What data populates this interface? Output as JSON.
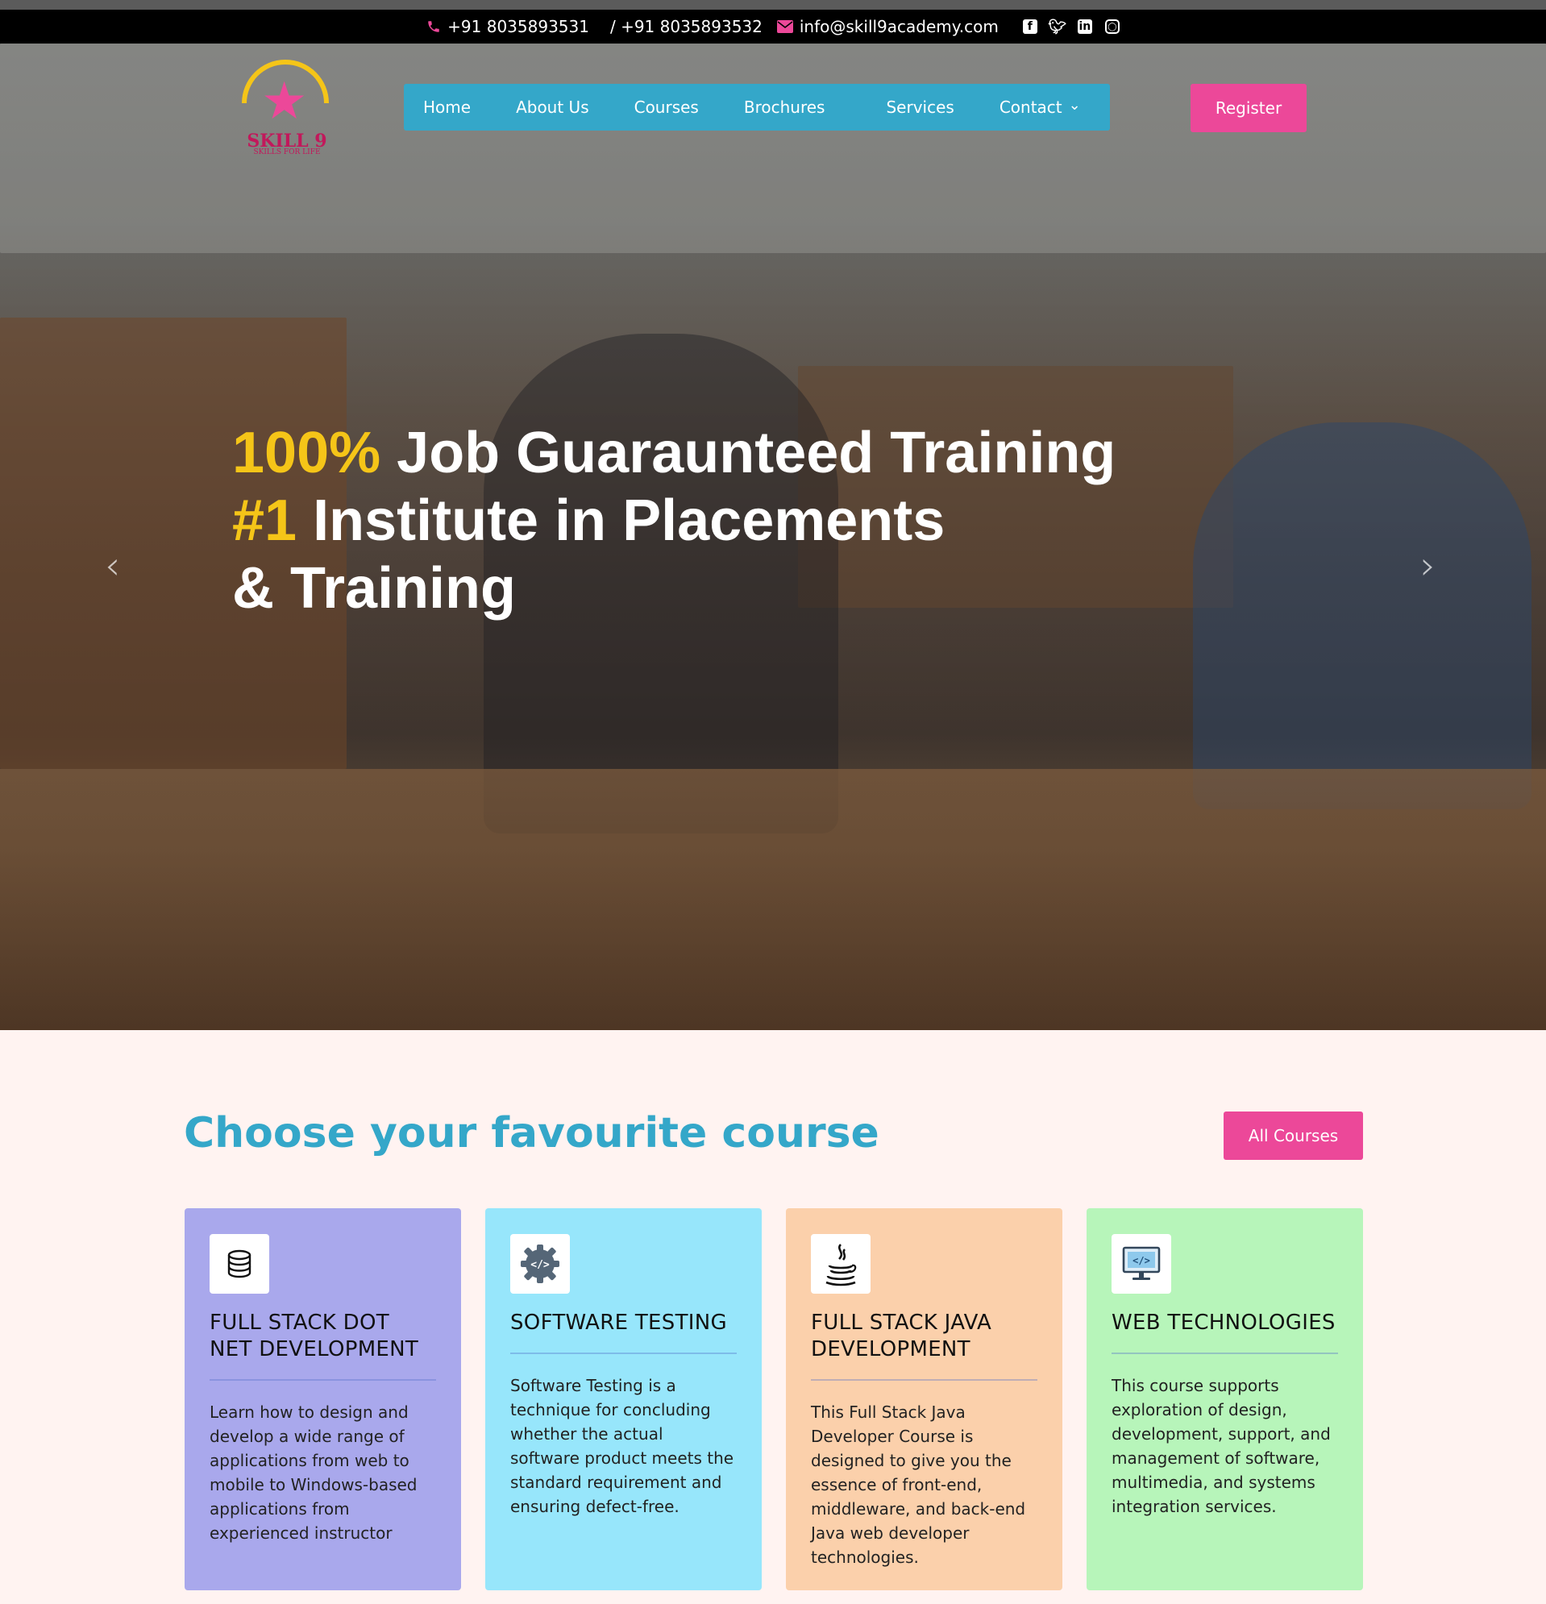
{
  "topbar": {
    "phone1": "+91 8035893531",
    "phone2": "/ +91 8035893532",
    "email": "info@skill9academy.com",
    "social_icons": [
      "facebook-icon",
      "twitter-icon",
      "linkedin-icon",
      "instagram-icon"
    ]
  },
  "logo": {
    "name": "SKILL 9",
    "tagline": "SKILLS FOR LIFE"
  },
  "nav": {
    "items": [
      "Home",
      "About Us",
      "Courses",
      "Brochures",
      "Services",
      "Contact"
    ],
    "register": "Register"
  },
  "hero": {
    "line1_highlight": "100%",
    "line1_rest": " Job Guaraunteed Training",
    "line2_highlight": "#1",
    "line2_rest": " Institute in Placements",
    "line3": "& Training",
    "slides_count": 2,
    "active_slide": 1
  },
  "courses": {
    "title": "Choose your favourite course",
    "all_button": "All Courses",
    "items": [
      {
        "title": "FULL STACK DOT NET DEVELOPMENT",
        "description": "Learn how to design and develop a wide range of applications from web to mobile to Windows-based applications from experienced instructor",
        "color": "#a9a8ec",
        "icon": "database-icon"
      },
      {
        "title": "SOFTWARE TESTING",
        "description": "Software Testing is a technique for concluding whether the actual software product meets the standard requirement and ensuring defect-free.",
        "color": "#97e6fb",
        "icon": "code-gear-icon"
      },
      {
        "title": "FULL STACK JAVA DEVELOPMENT",
        "description": "This Full Stack Java Developer Course is designed to give you the essence of front-end, middleware, and back-end Java web developer technologies.",
        "color": "#fbd0ab",
        "icon": "java-icon"
      },
      {
        "title": "WEB TECHNOLOGIES",
        "description": "This course supports exploration of design, development, support, and management of software, multimedia, and systems integration services.",
        "color": "#b7f5ba",
        "icon": "monitor-code-icon"
      }
    ]
  },
  "colors": {
    "accent": "#34a7c9",
    "brand_pink": "#ec4899",
    "highlight": "#f5c518"
  }
}
